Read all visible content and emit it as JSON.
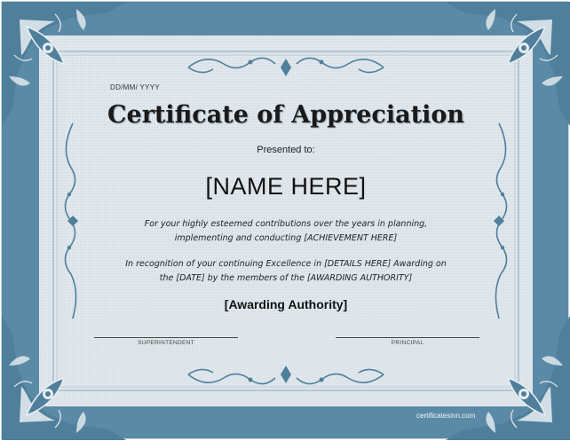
{
  "certificate": {
    "date": "DD/MM/ YYYY",
    "title": "Certificate of Appreciation",
    "presented_to": "Presented to:",
    "name": "[NAME HERE]",
    "paragraph1": "For your highly esteemed contributions over the years in planning, implementing and conducting [ACHIEVEMENT HERE]",
    "paragraph2": "In recognition of your continuing Excellence in [DETAILS HERE] Awarding on the [DATE] by the members of the [AWARDING AUTHORITY]",
    "awarding_authority": "[Awarding Authority]",
    "signature_left": "SUPERINTENDENT",
    "signature_right": "PRINCIPAL",
    "footer": "certificatesinn.com"
  },
  "colors": {
    "frame": "#5b8aa6",
    "paper": "#dfe7ec",
    "ornament": "#4f7f9b"
  },
  "icons": [
    "corner-ornament-icon",
    "scroll-flourish-icon"
  ]
}
